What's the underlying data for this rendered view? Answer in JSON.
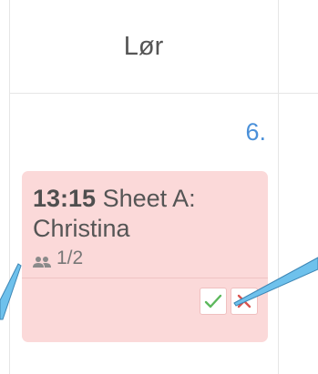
{
  "calendar": {
    "day_header": "Lør",
    "day_number": "6."
  },
  "event": {
    "time": "13:15",
    "title": "Sheet A: Christina",
    "attendees": "1/2",
    "background_color": "#fbd9d9",
    "accept_color": "#5cb85c",
    "reject_color": "#d9534f"
  },
  "icons": {
    "attendees": "people-icon",
    "accept": "checkmark-icon",
    "reject": "close-icon"
  },
  "annotations": {
    "arrow_color": "#6ec1ec"
  }
}
